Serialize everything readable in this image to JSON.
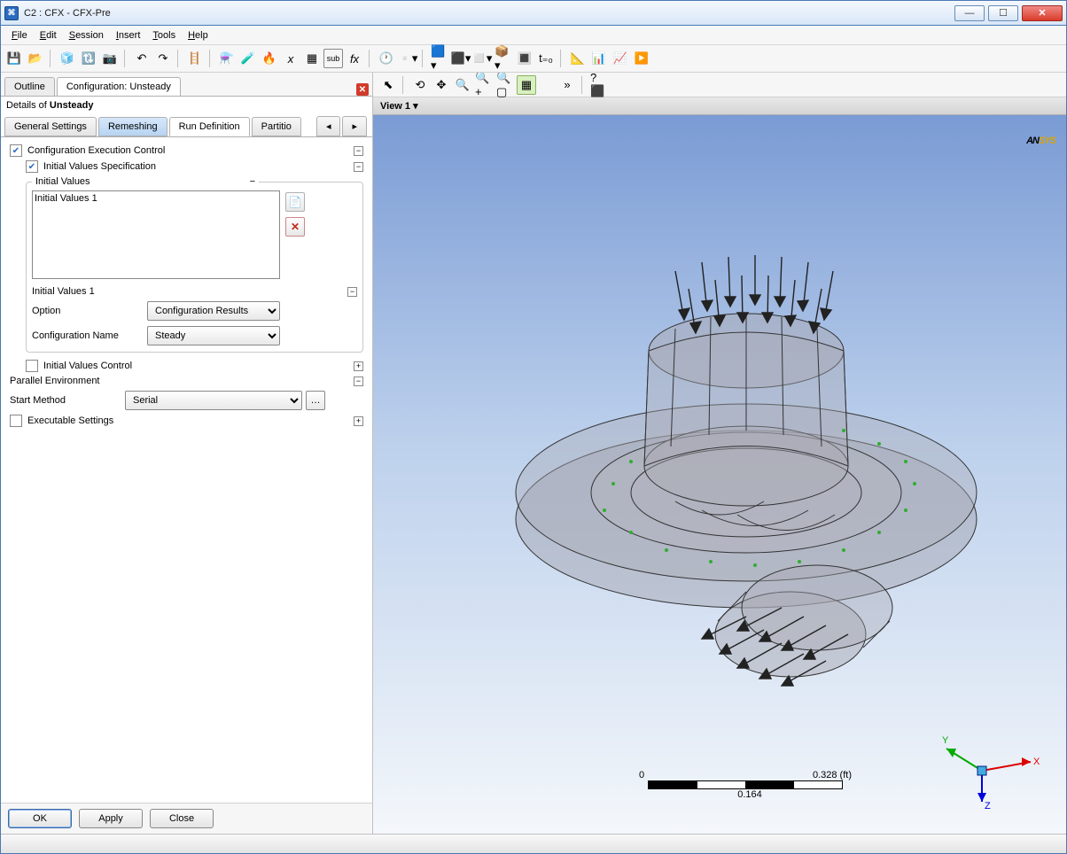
{
  "window": {
    "title": "C2 : CFX - CFX-Pre"
  },
  "menu": {
    "file": "File",
    "edit": "Edit",
    "session": "Session",
    "insert": "Insert",
    "tools": "Tools",
    "help": "Help"
  },
  "tabs1": {
    "outline": "Outline",
    "config": "Configuration: Unsteady"
  },
  "details": {
    "prefix": "Details of ",
    "name": "Unsteady"
  },
  "tabs2": {
    "general": "General Settings",
    "remesh": "Remeshing",
    "rundef": "Run Definition",
    "partition": "Partitio"
  },
  "form": {
    "cfg_exec": "Configuration Execution Control",
    "ivs": "Initial Values Specification",
    "iv_legend": "Initial Values",
    "iv_item": "Initial Values 1",
    "iv1_hdr": "Initial Values 1",
    "option_lbl": "Option",
    "option_val": "Configuration Results",
    "cfgname_lbl": "Configuration Name",
    "cfgname_val": "Steady",
    "ivc": "Initial Values Control",
    "parenv": "Parallel Environment",
    "start_lbl": "Start Method",
    "start_val": "Serial",
    "exec": "Executable Settings"
  },
  "buttons": {
    "ok": "OK",
    "apply": "Apply",
    "close": "Close"
  },
  "view": {
    "header": "View 1 ▾"
  },
  "scale": {
    "zero": "0",
    "mid": "0.164",
    "end": "0.328",
    "unit": "(ft)"
  },
  "triad": {
    "x": "X",
    "y": "Y",
    "z": "Z"
  },
  "logo": {
    "an": "AN",
    "sys": "SYS"
  }
}
